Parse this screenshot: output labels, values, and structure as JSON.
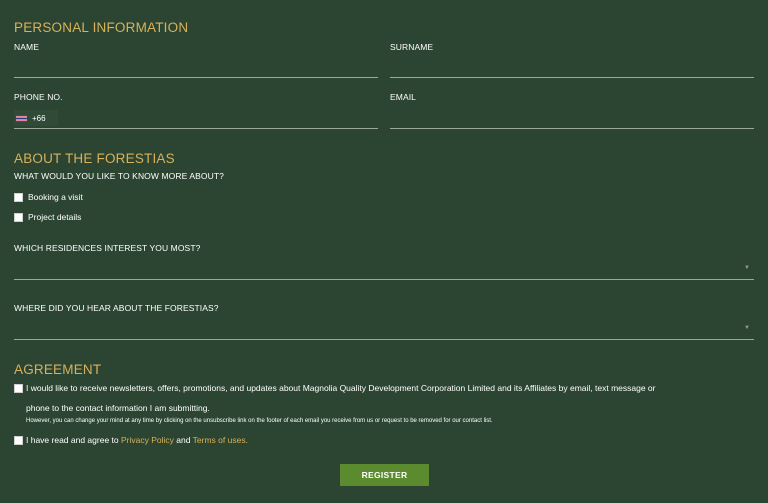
{
  "personal": {
    "title": "PERSONAL INFORMATION",
    "name_label": "NAME",
    "surname_label": "SURNAME",
    "phone_label": "PHONE NO.",
    "phone_code": "+66",
    "email_label": "EMAIL"
  },
  "about": {
    "title": "ABOUT THE FORESTIAS",
    "question": "WHAT WOULD YOU LIKE TO KNOW MORE ABOUT?",
    "options": [
      "Booking a visit",
      "Project details"
    ],
    "residences_label": "WHICH RESIDENCES INTEREST YOU MOST?",
    "hear_label": "WHERE DID YOU HEAR ABOUT THE FORESTIAS?",
    "caret": "▼"
  },
  "agreement": {
    "title": "AGREEMENT",
    "newsletter_line1": "I would like to receive newsletters, offers, promotions, and updates about Magnolia Quality Development Corporation Limited and its Affiliates by email, text message or",
    "newsletter_line2": "phone to the contact information I am submitting.",
    "note": "However, you can change your mind at any time by clicking on the unsubscribe link on the footer of each email you receive from us or request to be removed for our contact list.",
    "terms_prefix": "I have read and agree to ",
    "privacy_link": "Privacy Policy",
    "and_text": " and ",
    "terms_link": "Terms of uses."
  },
  "register_label": "REGISTER",
  "colors": {
    "background": "#2b4532",
    "accent_gold": "#d8b15a",
    "button_green": "#5c8a2f"
  }
}
